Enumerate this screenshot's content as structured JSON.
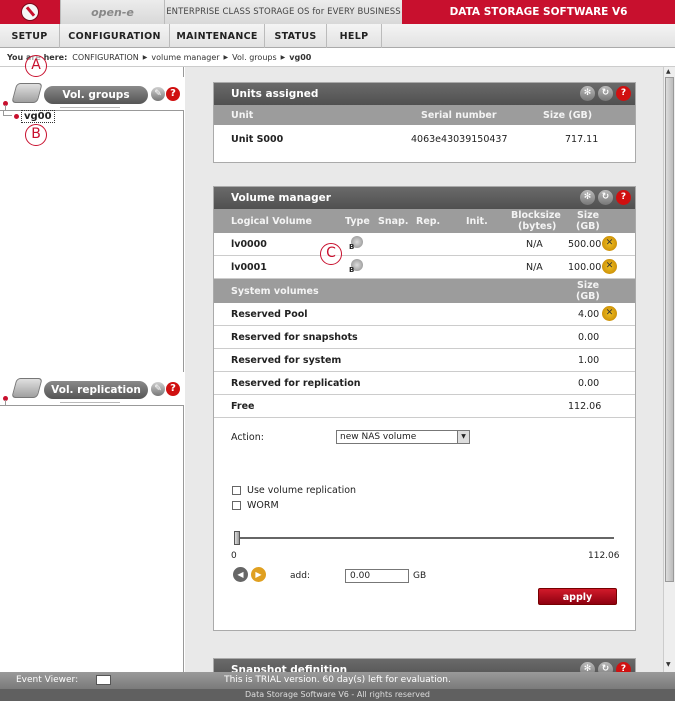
{
  "header": {
    "brand": "open-e",
    "tagline": "ENTERPRISE CLASS STORAGE OS for EVERY BUSINESS",
    "product": "DATA STORAGE SOFTWARE V6"
  },
  "menu": [
    "SETUP",
    "CONFIGURATION",
    "MAINTENANCE",
    "STATUS",
    "HELP"
  ],
  "breadcrumb": {
    "label": "You are here:",
    "items": [
      "CONFIGURATION",
      "volume manager",
      "Vol. groups",
      "vg00"
    ]
  },
  "left_panel": {
    "vol_groups_title": "Vol. groups",
    "tree_item": "vg00",
    "vol_replication_title": "Vol. replication"
  },
  "callouts": [
    "A",
    "B",
    "C"
  ],
  "units_assigned": {
    "title": "Units assigned",
    "columns": [
      "Unit",
      "Serial number",
      "Size (GB)"
    ],
    "rows": [
      {
        "unit": "Unit S000",
        "serial": "4063e43039150437",
        "size": "717.11"
      }
    ]
  },
  "volume_manager": {
    "title": "Volume manager",
    "columns": [
      "Logical Volume",
      "Type",
      "Snap.",
      "Rep.",
      "Init.",
      "Blocksize",
      "(bytes)",
      "Size",
      "(GB)"
    ],
    "volumes": [
      {
        "name": "lv0000",
        "blocksize": "N/A",
        "size": "500.00"
      },
      {
        "name": "lv0001",
        "blocksize": "N/A",
        "size": "100.00"
      }
    ],
    "system_header": "System volumes",
    "system_size_header": [
      "Size",
      "(GB)"
    ],
    "system_rows": [
      {
        "name": "Reserved Pool",
        "size": "4.00"
      },
      {
        "name": "Reserved for snapshots",
        "size": "0.00"
      },
      {
        "name": "Reserved for system",
        "size": "1.00"
      },
      {
        "name": "Reserved for replication",
        "size": "0.00"
      },
      {
        "name": "Free",
        "size": "112.06"
      }
    ],
    "action_label": "Action:",
    "action_value": "new NAS volume",
    "use_replication": "Use volume replication",
    "worm": "WORM",
    "slider_min": "0",
    "slider_max": "112.06",
    "add_label": "add:",
    "add_value": "0.00",
    "add_unit": "GB",
    "apply": "apply"
  },
  "snapshot_definition_title": "Snapshot definition",
  "footer": {
    "event_viewer": "Event Viewer:",
    "trial": "This is TRIAL version. 60 day(s) left for evaluation.",
    "copyright": "Data Storage Software V6 - All rights reserved"
  }
}
